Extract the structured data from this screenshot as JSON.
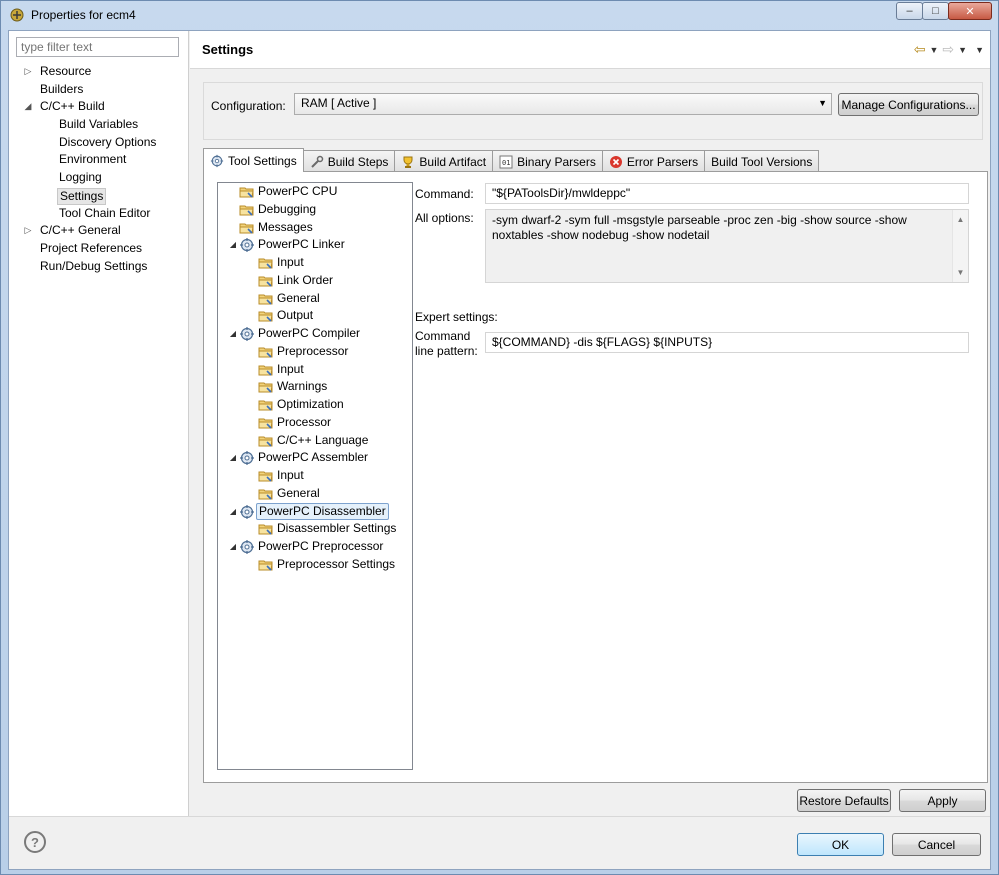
{
  "window": {
    "title": "Properties for ecm4"
  },
  "filter": {
    "placeholder": "type filter text"
  },
  "left_tree": [
    {
      "label": "Resource",
      "level": 0,
      "arrow": "collapsed"
    },
    {
      "label": "Builders",
      "level": 0,
      "arrow": "none"
    },
    {
      "label": "C/C++ Build",
      "level": 0,
      "arrow": "expanded"
    },
    {
      "label": "Build Variables",
      "level": 1,
      "arrow": "none"
    },
    {
      "label": "Discovery Options",
      "level": 1,
      "arrow": "none"
    },
    {
      "label": "Environment",
      "level": 1,
      "arrow": "none"
    },
    {
      "label": "Logging",
      "level": 1,
      "arrow": "none"
    },
    {
      "label": "Settings",
      "level": 1,
      "arrow": "none",
      "selected": true
    },
    {
      "label": "Tool Chain Editor",
      "level": 1,
      "arrow": "none"
    },
    {
      "label": "C/C++ General",
      "level": 0,
      "arrow": "collapsed"
    },
    {
      "label": "Project References",
      "level": 0,
      "arrow": "none"
    },
    {
      "label": "Run/Debug Settings",
      "level": 0,
      "arrow": "none"
    }
  ],
  "header": {
    "title": "Settings"
  },
  "configuration": {
    "label": "Configuration:",
    "value": "RAM  [ Active ]",
    "manage_button": "Manage Configurations..."
  },
  "tabs": [
    {
      "label": "Tool Settings",
      "icon": "gear-icon",
      "active": true
    },
    {
      "label": "Build Steps",
      "icon": "wrench-icon"
    },
    {
      "label": "Build Artifact",
      "icon": "trophy-icon"
    },
    {
      "label": "Binary Parsers",
      "icon": "binary-icon"
    },
    {
      "label": "Error Parsers",
      "icon": "error-icon"
    },
    {
      "label": "Build Tool Versions",
      "icon": ""
    }
  ],
  "tool_tree": [
    {
      "label": "PowerPC CPU",
      "level": 1,
      "arrow": "none",
      "icon": "folder-icon"
    },
    {
      "label": "Debugging",
      "level": 1,
      "arrow": "none",
      "icon": "folder-icon"
    },
    {
      "label": "Messages",
      "level": 1,
      "arrow": "none",
      "icon": "folder-icon"
    },
    {
      "label": "PowerPC Linker",
      "level": 1,
      "arrow": "expanded",
      "icon": "gear-icon"
    },
    {
      "label": "Input",
      "level": 2,
      "arrow": "none",
      "icon": "folder-icon"
    },
    {
      "label": "Link Order",
      "level": 2,
      "arrow": "none",
      "icon": "folder-icon"
    },
    {
      "label": "General",
      "level": 2,
      "arrow": "none",
      "icon": "folder-icon"
    },
    {
      "label": "Output",
      "level": 2,
      "arrow": "none",
      "icon": "folder-icon"
    },
    {
      "label": "PowerPC Compiler",
      "level": 1,
      "arrow": "expanded",
      "icon": "gear-icon"
    },
    {
      "label": "Preprocessor",
      "level": 2,
      "arrow": "none",
      "icon": "folder-icon"
    },
    {
      "label": "Input",
      "level": 2,
      "arrow": "none",
      "icon": "folder-icon"
    },
    {
      "label": "Warnings",
      "level": 2,
      "arrow": "none",
      "icon": "folder-icon"
    },
    {
      "label": "Optimization",
      "level": 2,
      "arrow": "none",
      "icon": "folder-icon"
    },
    {
      "label": "Processor",
      "level": 2,
      "arrow": "none",
      "icon": "folder-icon"
    },
    {
      "label": "C/C++ Language",
      "level": 2,
      "arrow": "none",
      "icon": "folder-icon"
    },
    {
      "label": "PowerPC Assembler",
      "level": 1,
      "arrow": "expanded",
      "icon": "gear-icon"
    },
    {
      "label": "Input",
      "level": 2,
      "arrow": "none",
      "icon": "folder-icon"
    },
    {
      "label": "General",
      "level": 2,
      "arrow": "none",
      "icon": "folder-icon"
    },
    {
      "label": "PowerPC Disassembler",
      "level": 1,
      "arrow": "expanded",
      "icon": "gear-icon",
      "selected": true
    },
    {
      "label": "Disassembler Settings",
      "level": 2,
      "arrow": "none",
      "icon": "folder-icon"
    },
    {
      "label": "PowerPC Preprocessor",
      "level": 1,
      "arrow": "expanded",
      "icon": "gear-icon"
    },
    {
      "label": "Preprocessor Settings",
      "level": 2,
      "arrow": "none",
      "icon": "folder-icon"
    }
  ],
  "options": {
    "command_label": "Command:",
    "command_value": "\"${PAToolsDir}/mwldeppc\"",
    "all_options_label": "All options:",
    "all_options_value": "-sym dwarf-2 -sym full -msgstyle parseable -proc zen -big -show source -show noxtables -show nodebug -show nodetail",
    "expert_label": "Expert settings:",
    "pattern_label_1": "Command",
    "pattern_label_2": "line pattern:",
    "pattern_value": "${COMMAND} -dis ${FLAGS} ${INPUTS}"
  },
  "buttons": {
    "restore_defaults": "Restore Defaults",
    "apply": "Apply",
    "ok": "OK",
    "cancel": "Cancel"
  },
  "colors": {
    "window_frame": "#b9cfe8",
    "selection": "#e5f1fb",
    "accent": "#3c7fb1"
  }
}
